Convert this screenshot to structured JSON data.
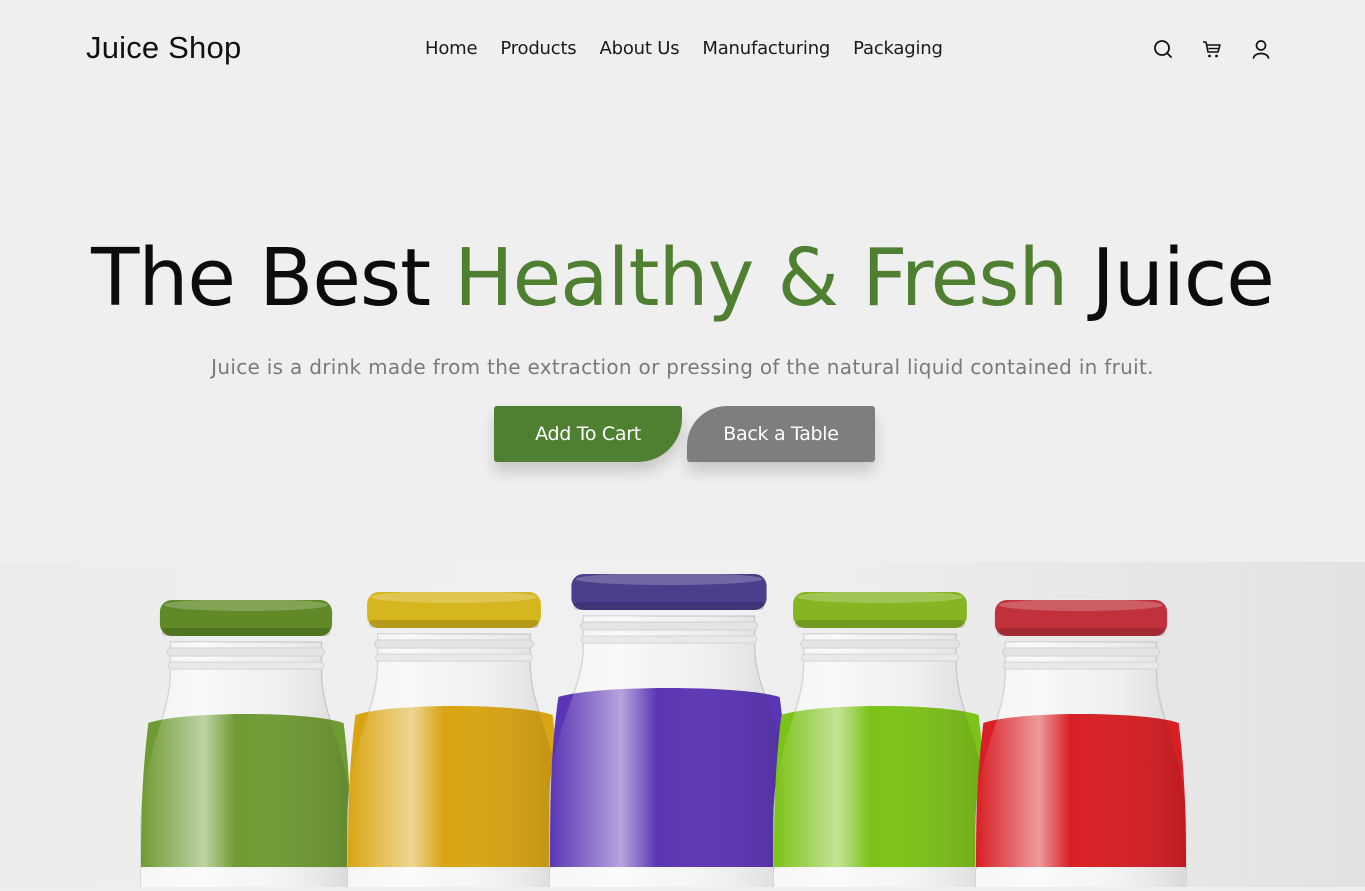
{
  "brand": "Juice Shop",
  "nav": [
    "Home",
    "Products",
    "About Us",
    "Manufacturing",
    "Packaging"
  ],
  "icons": [
    "search-icon",
    "cart-icon",
    "user-icon"
  ],
  "hero": {
    "title_start": "The Best ",
    "title_highlight": "Healthy & Fresh",
    "title_end": " Juice",
    "subtitle": "Juice is a drink made from the extraction or pressing of the natural liquid contained in fruit.",
    "primary_button": "Add To Cart",
    "secondary_button": "Back a Table"
  },
  "colors": {
    "accent": "#4f7f30",
    "background": "#efefef",
    "secondary_button": "#7e7e7e"
  },
  "bottles": [
    {
      "cap": "#5f8a27",
      "juice": "#6f9b34"
    },
    {
      "cap": "#d5b61f",
      "juice": "#d9a514"
    },
    {
      "cap": "#4b3e8c",
      "juice": "#5b36b4"
    },
    {
      "cap": "#86b524",
      "juice": "#7cc219"
    },
    {
      "cap": "#c0313b",
      "juice": "#d71f25"
    }
  ]
}
